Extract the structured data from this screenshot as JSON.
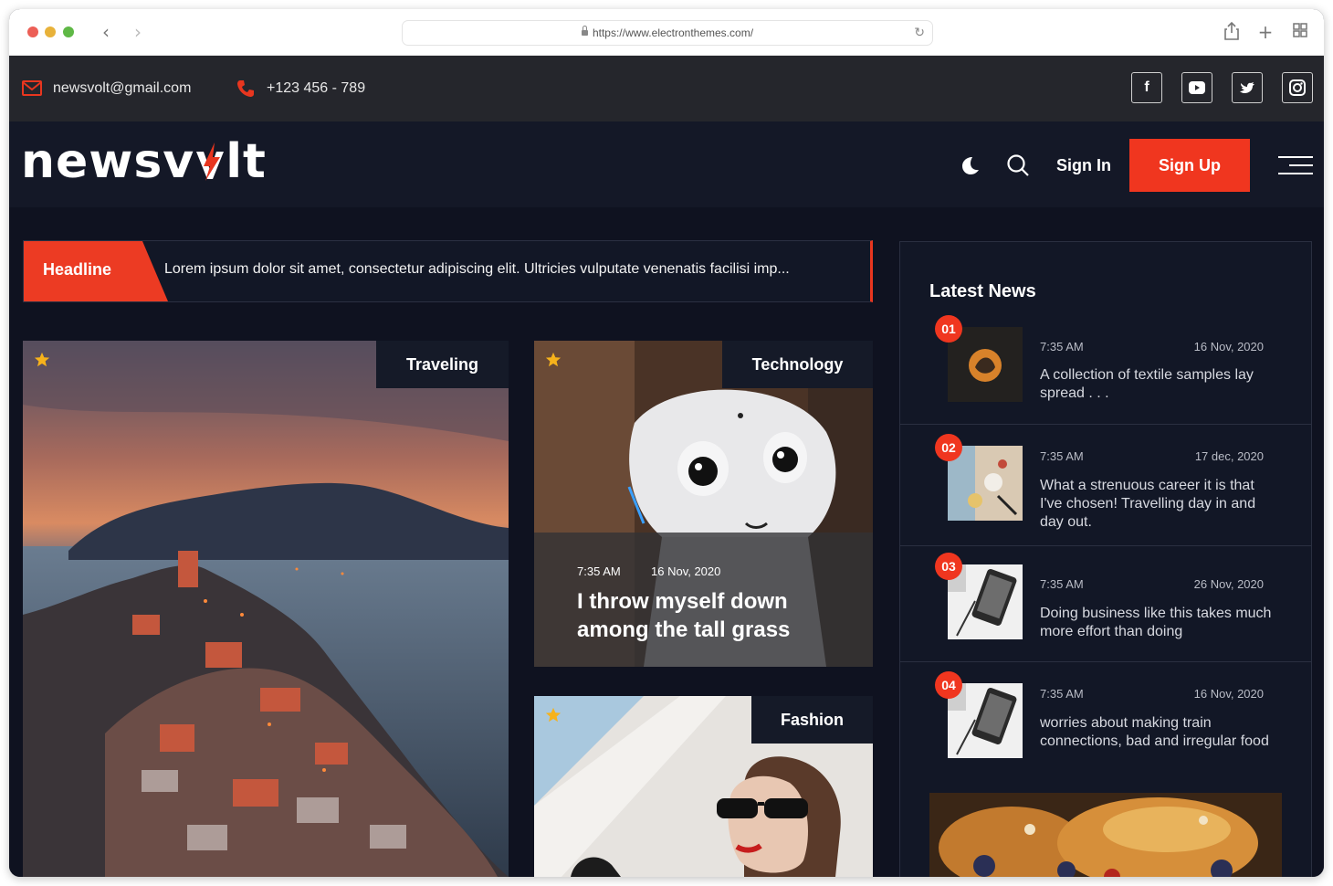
{
  "browser": {
    "url": "https://www.electronthemes.com/"
  },
  "topbar": {
    "email": "newsvolt@gmail.com",
    "phone": "+123 456 - 789",
    "social": [
      {
        "name": "facebook-icon",
        "glyph": "f"
      },
      {
        "name": "youtube-icon",
        "glyph": "▶"
      },
      {
        "name": "twitter-icon",
        "glyph": "t"
      },
      {
        "name": "instagram-icon",
        "glyph": "◎"
      }
    ]
  },
  "header": {
    "logo_part1": "newsv",
    "logo_bolt": "ɤ",
    "logo_part2": "lt",
    "signin_label": "Sign In",
    "signup_label": "Sign Up"
  },
  "headline": {
    "tag": "Headline",
    "text": "Lorem ipsum dolor sit amet, consectetur adipiscing elit. Ultricies vulputate venenatis facilisi imp..."
  },
  "cards": {
    "traveling": {
      "category": "Traveling"
    },
    "technology": {
      "category": "Technology",
      "time": "7:35 AM",
      "date": "16 Nov, 2020",
      "title_line1": "I throw myself down",
      "title_line2": "among the tall grass"
    },
    "fashion": {
      "category": "Fashion"
    }
  },
  "sidebar": {
    "title": "Latest News",
    "items": [
      {
        "num": "01",
        "time": "7:35 AM",
        "date": "16 Nov, 2020",
        "title": "A collection of textile samples lay spread . . ."
      },
      {
        "num": "02",
        "time": "7:35 AM",
        "date": "17 dec, 2020",
        "title": "What a strenuous career it is that I've chosen! Travelling day in and day out."
      },
      {
        "num": "03",
        "time": "7:35 AM",
        "date": "26 Nov, 2020",
        "title": "Doing business like this takes much more effort than doing"
      },
      {
        "num": "04",
        "time": "7:35 AM",
        "date": "16 Nov, 2020",
        "title": "worries about making train connections, bad and irregular food"
      }
    ]
  },
  "colors": {
    "accent": "#f0361f",
    "header_bg": "#141827",
    "topbar_bg": "#25262c",
    "page_bg": "#0f1220"
  }
}
